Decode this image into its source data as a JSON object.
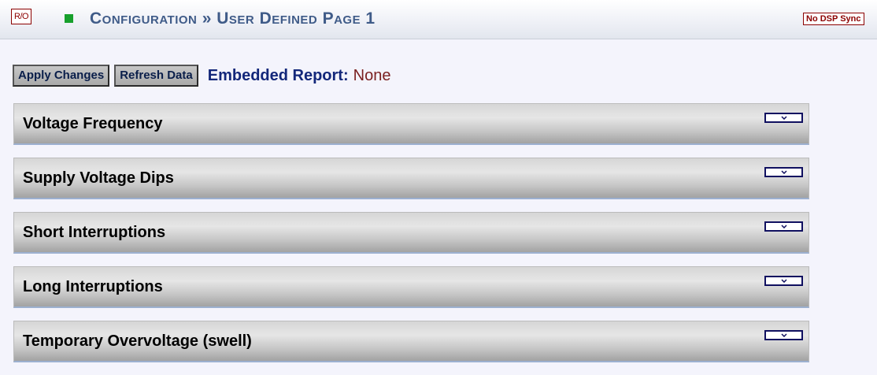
{
  "header": {
    "ro_badge": "R/O",
    "title": "Configuration » User Defined Page 1",
    "dsp_badge": "No DSP Sync"
  },
  "toolbar": {
    "apply_label": "Apply Changes",
    "refresh_label": "Refresh Data",
    "report_label": "Embedded Report:",
    "report_value": "None"
  },
  "sections": [
    {
      "title": "Voltage Frequency",
      "icon": "chevron-down-icon"
    },
    {
      "title": "Supply Voltage Dips",
      "icon": "chevron-down-icon"
    },
    {
      "title": "Short Interruptions",
      "icon": "chevron-down-icon"
    },
    {
      "title": "Long Interruptions",
      "icon": "chevron-down-icon"
    },
    {
      "title": "Temporary Overvoltage (swell)",
      "icon": "chevron-down-icon"
    }
  ],
  "colors": {
    "status": "#17a02c",
    "title": "#3f5b88",
    "badge": "#8c0000",
    "report_label": "#13277a",
    "report_value": "#7a1f1f"
  }
}
